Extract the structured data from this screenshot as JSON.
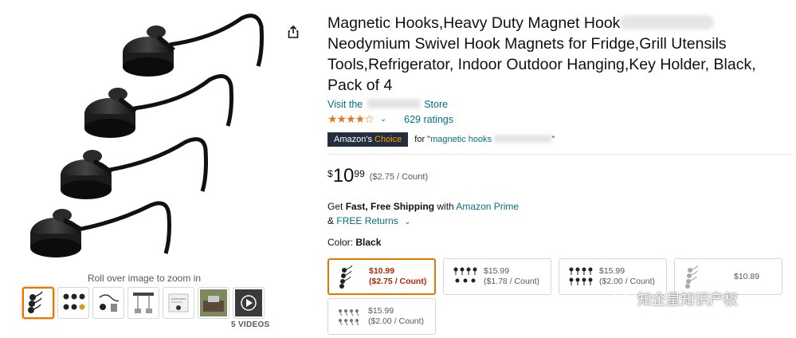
{
  "gallery": {
    "zoom_hint": "Roll over image to zoom in",
    "videos_label": "5 VIDEOS",
    "thumbnails": [
      "hooks-main",
      "hooks-set",
      "hooks-use-1",
      "hooks-use-2",
      "hooks-box",
      "hooks-lifestyle",
      "video"
    ]
  },
  "product": {
    "title_part1": "Magnetic Hooks,Heavy Duty Magnet Hook",
    "title_part2": "Neodymium Swivel Hook Magnets for Fridge,Grill Utensils Tools,Refrigerator, Indoor Outdoor Hanging,Key Holder, Black, Pack of 4",
    "store_prefix": "Visit the",
    "store_suffix": "Store",
    "stars_display": "★★★★☆",
    "ratings_text": "629 ratings",
    "choice_label_a": "Amazon's",
    "choice_label_b": "Choice",
    "for_prefix": "for \"",
    "for_keyword": "magnetic hooks",
    "for_suffix": "\"",
    "price_symbol": "$",
    "price_whole": "10",
    "price_fraction": "99",
    "unit_price": "($2.75 / Count)",
    "shipping_prefix": "Get",
    "shipping_bold": "Fast, Free Shipping",
    "shipping_mid": "with",
    "shipping_link": "Amazon Prime",
    "returns_prefix": "&",
    "returns_link": "FREE Returns",
    "color_label": "Color:",
    "color_value": "Black"
  },
  "swatches": [
    {
      "price": "$10.99",
      "unit": "($2.75 / Count)",
      "selected": true
    },
    {
      "price": "$15.99",
      "unit": "($1.78 / Count)",
      "selected": false
    },
    {
      "price": "$15.99",
      "unit": "($2.00 / Count)",
      "selected": false
    },
    {
      "price": "$10.89",
      "unit": "",
      "selected": false
    },
    {
      "price": "$15.99",
      "unit": "($2.00 / Count)",
      "selected": false
    }
  ],
  "watermark": {
    "text": "知企星知识产权"
  },
  "colors": {
    "link": "#007185",
    "star": "#de7921",
    "selected_border": "#e77600",
    "price_red": "#b12704",
    "badge_bg": "#232f3e"
  }
}
